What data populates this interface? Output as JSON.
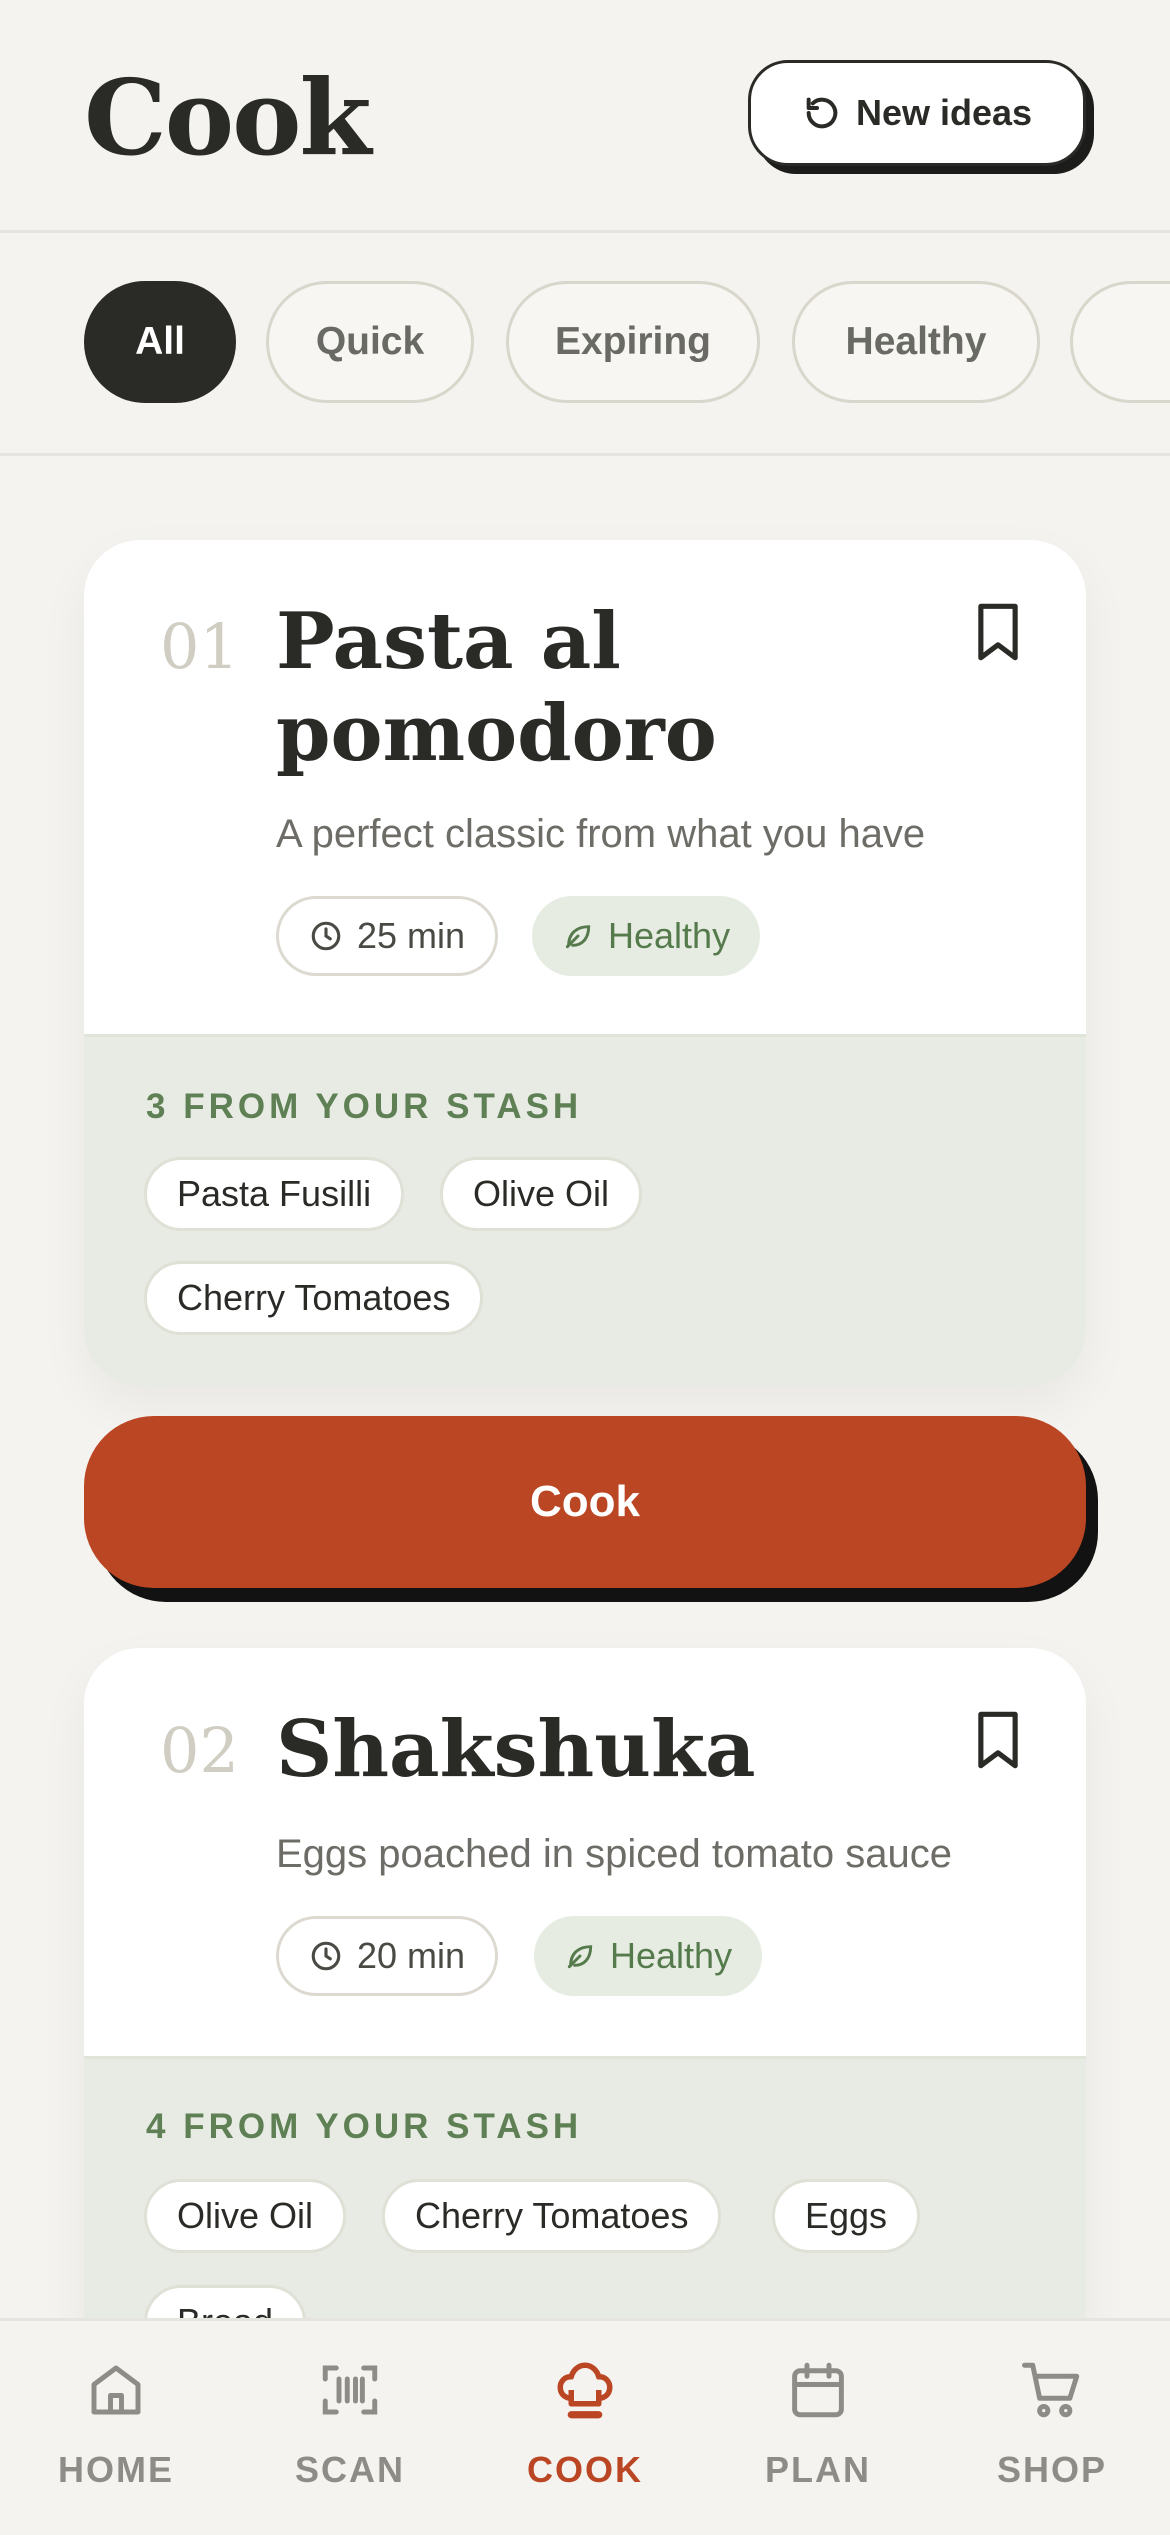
{
  "header": {
    "title": "Cook",
    "new_ideas_label": "New ideas"
  },
  "filters": [
    "All",
    "Quick",
    "Expiring",
    "Healthy"
  ],
  "recipes": [
    {
      "number": "01",
      "title_line1": "Pasta al",
      "title_line2": "pomodoro",
      "description": "A perfect classic from what you have",
      "time": "25 min",
      "tag": "Healthy",
      "stash_title": "3 FROM YOUR STASH",
      "ingredients": [
        "Pasta Fusilli",
        "Olive Oil",
        "Cherry Tomatoes"
      ]
    },
    {
      "number": "02",
      "title": "Shakshuka",
      "description": "Eggs poached in spiced tomato sauce",
      "time": "20 min",
      "tag": "Healthy",
      "stash_title": "4 FROM YOUR STASH",
      "ingredients": [
        "Olive Oil",
        "Cherry Tomatoes",
        "Eggs",
        "Bread"
      ]
    }
  ],
  "cook_button_label": "Cook",
  "nav": [
    {
      "label": "HOME",
      "icon": "home-icon"
    },
    {
      "label": "SCAN",
      "icon": "barcode-scan-icon"
    },
    {
      "label": "COOK",
      "icon": "chef-hat-icon",
      "active": true
    },
    {
      "label": "PLAN",
      "icon": "calendar-icon"
    },
    {
      "label": "SHOP",
      "icon": "cart-icon"
    }
  ],
  "colors": {
    "background": "#f4f3ef",
    "accent": "#bb4623",
    "healthy_green": "#557a4c",
    "stash_bg": "#e7ebe3",
    "dark": "#2a2a26"
  }
}
